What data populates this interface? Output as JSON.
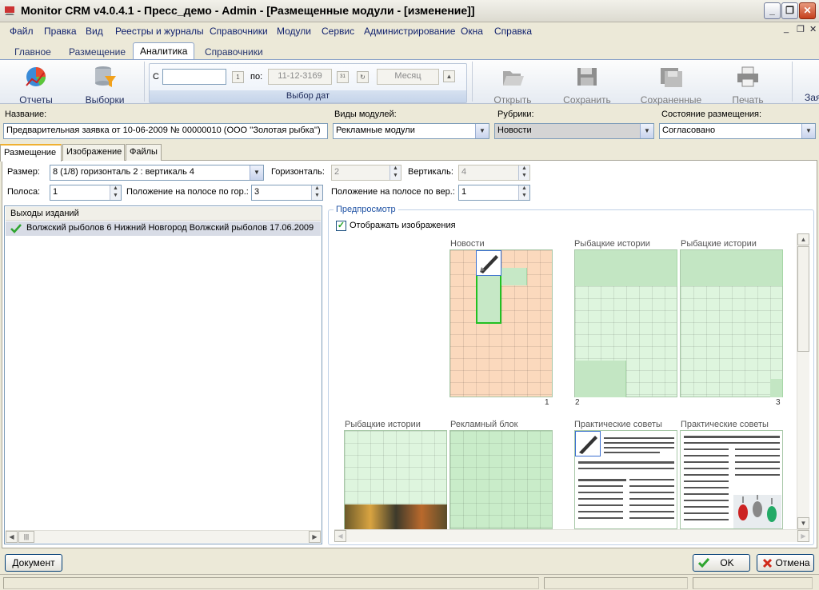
{
  "window": {
    "title": "Monitor CRM v4.0.4.1 - Пресс_демо - Admin - [Размещенные модули - [изменение]]"
  },
  "menu": [
    "Файл",
    "Правка",
    "Вид",
    "Реестры и журналы",
    "Справочники",
    "Модули",
    "Сервис",
    "Администрирование",
    "Окна",
    "Справка"
  ],
  "ribbon_tabs": [
    "Главное",
    "Размещение",
    "Аналитика",
    "Справочники"
  ],
  "ribbon": {
    "reports_label": "Отчеты",
    "selections_label": "Выборки",
    "date_from_label": "С",
    "date_from_value": "",
    "date_to_label": "по:",
    "date_to_value": "11-12-3169",
    "period_value": "Месяц",
    "date_group_caption": "Выбор дат",
    "open_label": "Открыть",
    "save_label": "Сохранить",
    "saved_label": "Сохраненные",
    "print_label": "Печать",
    "cut_label": "Зая"
  },
  "form": {
    "name_label": "Название:",
    "name_value": "Предварительная заявка от 10-06-2009 № 00000010 (ООО ''Золотая рыбка'')",
    "module_types_label": "Виды модулей:",
    "module_types_value": "Рекламные модули",
    "rubrics_label": "Рубрики:",
    "rubrics_value": "Новости",
    "state_label": "Состояние размещения:",
    "state_value": "Согласовано"
  },
  "subtabs": [
    "Размещение",
    "Изображение",
    "Файлы"
  ],
  "placement": {
    "size_label": "Размер:",
    "size_value": "8 (1/8) горизонталь 2 : вертикаль 4",
    "horizontal_label": "Горизонталь:",
    "horizontal_value": "2",
    "vertical_label": "Вертикаль:",
    "vertical_value": "4",
    "band_label": "Полоса:",
    "band_value": "1",
    "pos_h_label": "Положение на полосе по гор.:",
    "pos_h_value": "3",
    "pos_v_label": "Положение на полосе по вер.:",
    "pos_v_value": "1"
  },
  "issues": {
    "header": "Выходы изданий",
    "rows": [
      "Волжский рыболов 6 Нижний Новгород Волжский рыболов 17.06.2009"
    ]
  },
  "preview": {
    "legend": "Предпросмотр",
    "show_images_label": "Отображать изображения",
    "pages": [
      {
        "title": "Новости",
        "num": "1"
      },
      {
        "title": "Рыбацкие истории",
        "num": "2"
      },
      {
        "title": "Рыбацкие истории",
        "num": "3"
      },
      {
        "title": "Рыбацкие истории",
        "num": ""
      },
      {
        "title": "Рекламный блок",
        "num": ""
      },
      {
        "title": "Практические советы",
        "num": ""
      },
      {
        "title": "Практические советы",
        "num": ""
      }
    ]
  },
  "footer": {
    "document_label": "Документ",
    "ok_label": "OK",
    "cancel_label": "Отмена"
  }
}
